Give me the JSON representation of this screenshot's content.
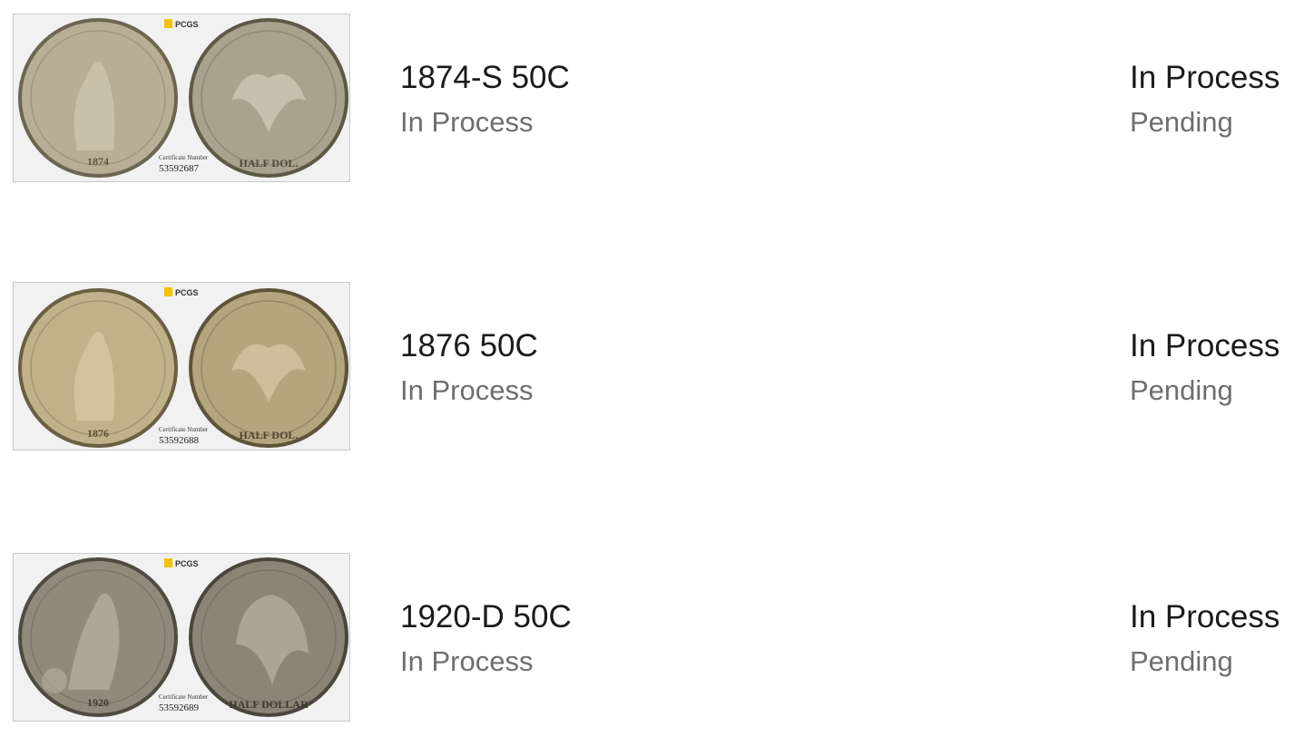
{
  "items": [
    {
      "title": "1874-S 50C",
      "subtitle": "In Process",
      "status": "In Process",
      "state": "Pending",
      "cert_label": "Certificate Number",
      "cert_number": "53592687",
      "logo_text": "PCGS",
      "obverse_date": "1874",
      "reverse_legend": "HALF DOL."
    },
    {
      "title": "1876 50C",
      "subtitle": "In Process",
      "status": "In Process",
      "state": "Pending",
      "cert_label": "Certificate Number",
      "cert_number": "53592688",
      "logo_text": "PCGS",
      "obverse_date": "1876",
      "reverse_legend": "HALF DOL."
    },
    {
      "title": "1920-D 50C",
      "subtitle": "In Process",
      "status": "In Process",
      "state": "Pending",
      "cert_label": "Certificate Number",
      "cert_number": "53592689",
      "logo_text": "PCGS",
      "obverse_date": "1920",
      "reverse_legend": "HALF DOLLAR"
    }
  ],
  "colors": {
    "title": "#1a1a1a",
    "muted": "#6e6e6e",
    "coin_silver": "#b7ae95",
    "coin_walker": "#8f8a7c",
    "logo_gold": "#f2c200"
  }
}
